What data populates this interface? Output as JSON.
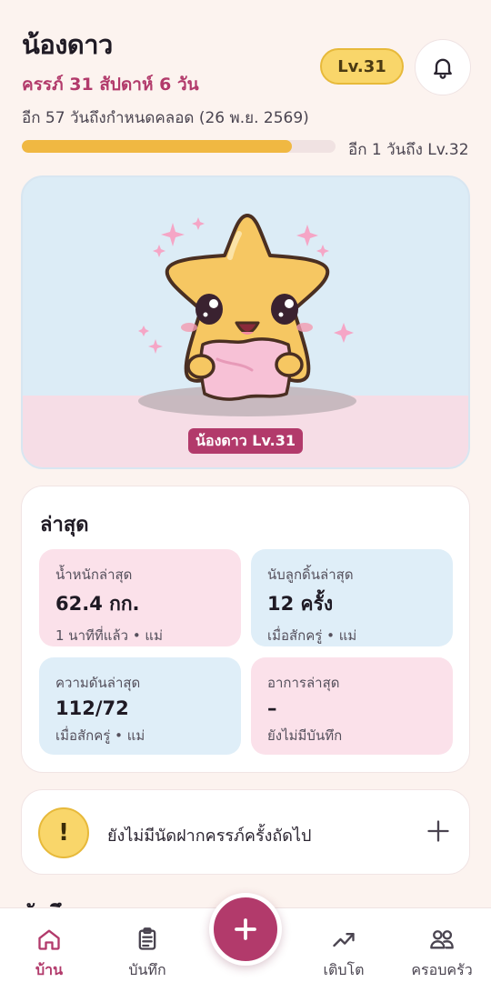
{
  "header": {
    "title": "น้องดาว",
    "pregnancy": "ครรภ์ 31 สัปดาห์ 6 วัน",
    "due": "อีก 57 วันถึงกำหนดคลอด (26 พ.ย. 2569)",
    "level_badge": "Lv.31",
    "bell_icon": "bell-icon"
  },
  "progress": {
    "fraction": 0.86,
    "text": "อีก 1 วันถึง Lv.32"
  },
  "pet": {
    "label": "น้องดาว Lv.31",
    "character": "star-mascot-holding-pillow"
  },
  "latest": {
    "title": "ล่าสุด",
    "tiles": [
      {
        "label": "น้ำหนักล่าสุด",
        "value": "62.4 กก.",
        "meta": "1 นาทีที่แล้ว • แม่"
      },
      {
        "label": "นับลูกดิ้นล่าสุด",
        "value": "12 ครั้ง",
        "meta": "เมื่อสักครู่ • แม่"
      },
      {
        "label": "ความดันล่าสุด",
        "value": "112/72",
        "meta": "เมื่อสักครู่ • แม่"
      },
      {
        "label": "อาการล่าสุด",
        "value": "–",
        "meta": "ยังไม่มีบันทึก"
      }
    ]
  },
  "appointment": {
    "icon_text": "!",
    "text": "ยังไม่มีนัดฝากครรภ์ครั้งถัดไป"
  },
  "section_peek": "บันทึก",
  "nav": {
    "items": [
      {
        "label": "บ้าน",
        "icon": "home-icon"
      },
      {
        "label": "บันทึก",
        "icon": "clipboard-icon"
      },
      {
        "label": "เติบโต",
        "icon": "trend-icon"
      },
      {
        "label": "ครอบครัว",
        "icon": "family-icon"
      }
    ],
    "fab_icon": "plus-icon"
  },
  "colors": {
    "accent": "#b23a6b",
    "gold": "#f0b842",
    "background": "#fcf3ef"
  }
}
